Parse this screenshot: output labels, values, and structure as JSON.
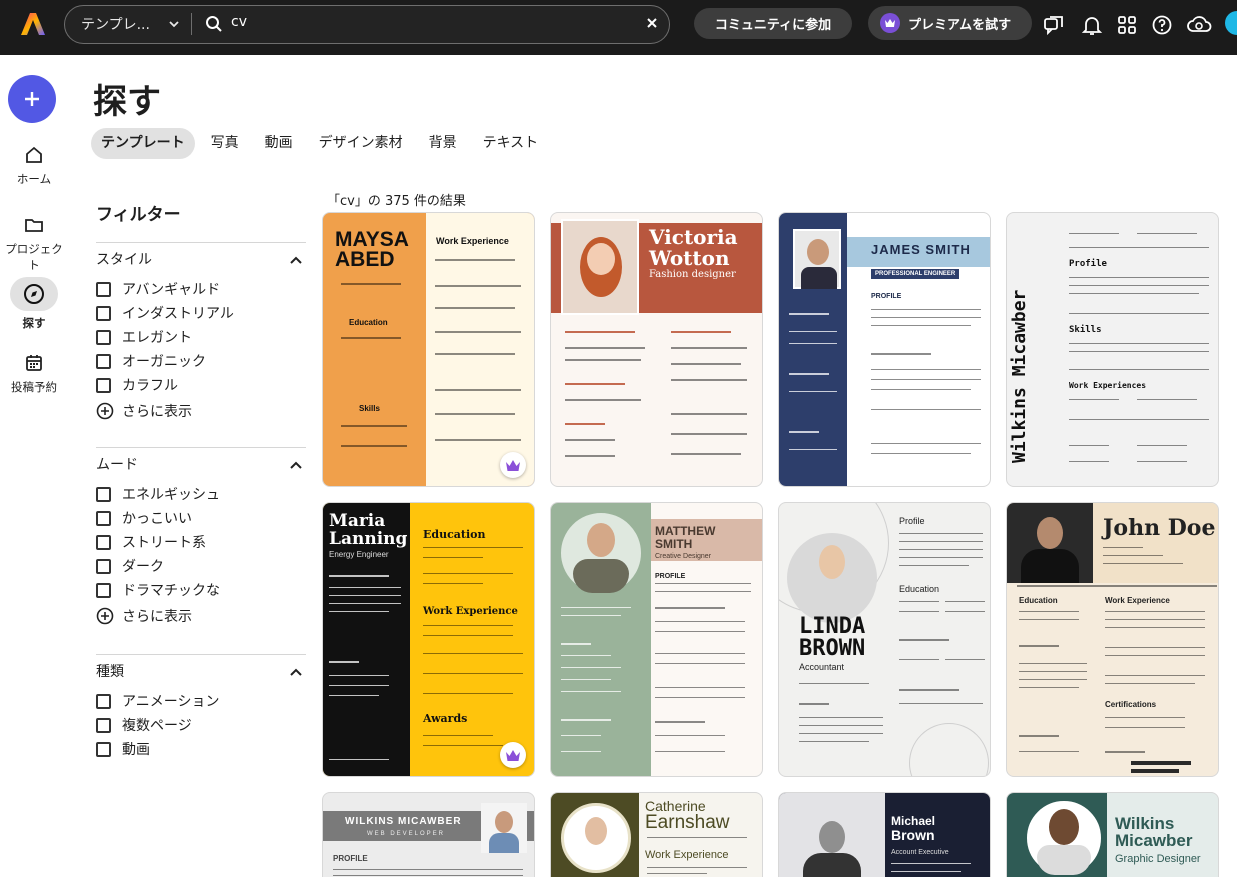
{
  "topbar": {
    "category": "テンプレ...",
    "search_value": "cv",
    "community_label": "コミュニティに参加",
    "premium_label": "プレミアムを試す"
  },
  "rail": {
    "home": "ホーム",
    "projects": "プロジェクト",
    "explore": "探す",
    "schedule": "投稿予約"
  },
  "page": {
    "title": "探す",
    "tabs": [
      "テンプレート",
      "写真",
      "動画",
      "デザイン素材",
      "背景",
      "テキスト"
    ]
  },
  "filters": {
    "title": "フィルター",
    "style": {
      "label": "スタイル",
      "options": [
        "アバンギャルド",
        "インダストリアル",
        "エレガント",
        "オーガニック",
        "カラフル"
      ],
      "more": "さらに表示"
    },
    "mood": {
      "label": "ムード",
      "options": [
        "エネルギッシュ",
        "かっこいい",
        "ストリート系",
        "ダーク",
        "ドラマチックな"
      ],
      "more": "さらに表示"
    },
    "type": {
      "label": "種類",
      "options": [
        "アニメーション",
        "複数ページ",
        "動画"
      ]
    }
  },
  "results": {
    "text": "「cv」の 375 件の結果"
  },
  "cards": [
    {
      "name1": "MAYSA",
      "name2": "ABED",
      "section": "Work Experience",
      "section2": "Education",
      "section3": "Skills"
    },
    {
      "name1": "Victoria",
      "name2": "Wotton",
      "role": "Fashion designer"
    },
    {
      "name1": "JAMES SMITH",
      "role": "PROFESSIONAL ENGINEER",
      "section": "PROFILE"
    },
    {
      "name1": "Wilkins Micawber",
      "section": "Profile",
      "section2": "Skills",
      "section3": "Work Experiences"
    },
    {
      "name1": "Maria",
      "name2": "Lanning",
      "role": "Energy Engineer",
      "section": "Education",
      "section2": "Work Experience",
      "section3": "Awards"
    },
    {
      "name1": "MATTHEW",
      "name2": "SMITH",
      "role": "Creative Designer",
      "section": "PROFILE"
    },
    {
      "name1": "LINDA",
      "name2": "BROWN",
      "role": "Accountant",
      "section": "Profile",
      "section2": "Education"
    },
    {
      "name1": "John Doe",
      "section": "Education",
      "section2": "Work Experience",
      "section3": "Certifications"
    },
    {
      "name1": "WILKINS MICAWBER",
      "role": "WEB DEVELOPER",
      "section": "PROFILE"
    },
    {
      "name1": "Catherine",
      "name2": "Earnshaw",
      "section": "Work Experience"
    },
    {
      "name1": "Michael",
      "name2": "Brown",
      "role": "Account Executive"
    },
    {
      "name1": "Wilkins",
      "name2": "Micawber",
      "role": "Graphic Designer"
    }
  ],
  "colors": {
    "topbar": "#1b1b1b",
    "accent": "#5258e4",
    "premium": "#7a4fd6"
  }
}
